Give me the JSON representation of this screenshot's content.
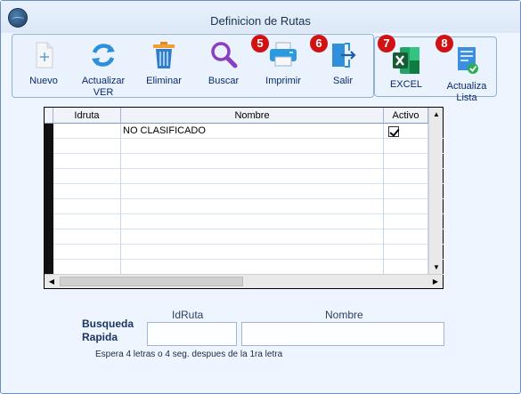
{
  "window": {
    "title": "Definicion de Rutas"
  },
  "toolbar": {
    "nuevo": "Nuevo",
    "actualizar_ver": "Actualizar VER",
    "eliminar": "Eliminar",
    "buscar": "Buscar",
    "imprimir": "Imprimir",
    "salir": "Salir",
    "excel": "EXCEL",
    "actualiza_lista": "Actualiza Lista"
  },
  "badges": {
    "imprimir": "5",
    "salir": "6",
    "excel": "7",
    "actualiza_lista": "8"
  },
  "grid": {
    "columns": [
      "Idruta",
      "Nombre",
      "Activo"
    ],
    "rows": [
      {
        "idruta": "",
        "nombre": "NO CLASIFICADO",
        "activo": true
      }
    ]
  },
  "search": {
    "title": "Busqueda Rapida",
    "idruta_label": "IdRuta",
    "nombre_label": "Nombre",
    "idruta_value": "",
    "nombre_value": "",
    "hint": "Espera 4 letras o 4 seg. despues de la 1ra letra"
  },
  "colors": {
    "accent": "#0a2a6a",
    "badge": "#d01212",
    "border": "#8db1dd"
  }
}
